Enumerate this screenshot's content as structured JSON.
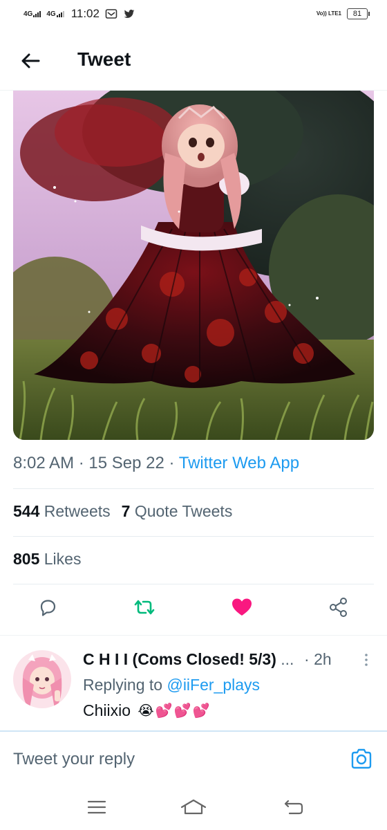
{
  "status_bar": {
    "network1": "4G",
    "network2": "4G",
    "time": "11:02",
    "volte": "Vo)) LTE1",
    "battery": "81"
  },
  "header": {
    "title": "Tweet"
  },
  "tweet": {
    "time": "8:02 AM",
    "date": "15 Sep 22",
    "source": "Twitter Web App",
    "retweets_count": "544",
    "retweets_label": "Retweets",
    "quotes_count": "7",
    "quotes_label": "Quote Tweets",
    "likes_count": "805",
    "likes_label": "Likes",
    "liked": true
  },
  "reply": {
    "name": "C H I I (Coms Closed! 5/3)",
    "ellipsis": "...",
    "time": "2h",
    "replying_to_label": "Replying to",
    "replying_to_handle": "@iiFer_plays",
    "text": "Chiixio"
  },
  "compose": {
    "placeholder": "Tweet your reply"
  },
  "colors": {
    "accent": "#1d9bf0",
    "like": "#f91880",
    "retweet": "#00ba7c",
    "secondary": "#536471"
  },
  "icons": [
    "back-arrow-icon",
    "reply-icon",
    "retweet-icon",
    "like-icon",
    "share-icon",
    "more-icon",
    "camera-icon",
    "menu-icon",
    "home-icon",
    "back-nav-icon"
  ]
}
